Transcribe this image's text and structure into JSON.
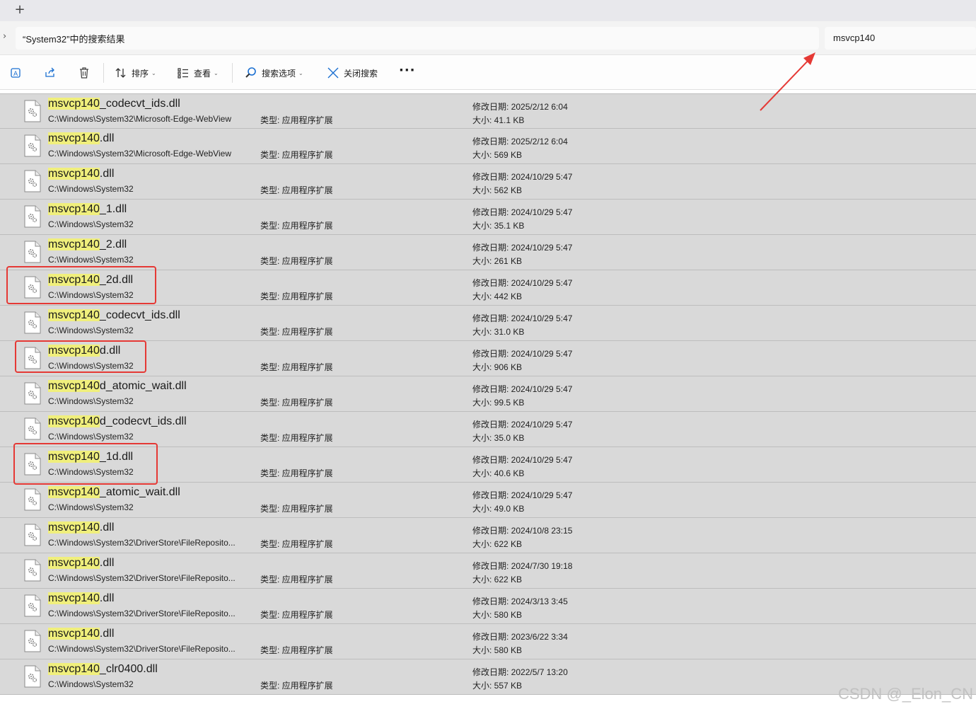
{
  "tabbar": {
    "new_tab_symbol": "+"
  },
  "address": {
    "chevron_symbol": "›",
    "path_text": "“System32”中的搜索结果",
    "search_value": "msvcp140"
  },
  "toolbar": {
    "sort_label": "排序",
    "view_label": "查看",
    "search_options_label": "搜索选项",
    "close_search_label": "关闭搜索",
    "more_symbol": "···",
    "dropdown_symbol": "⌄",
    "icons": [
      "rename-icon",
      "share-icon",
      "delete-icon",
      "sort-icon",
      "view-icon",
      "search-options-icon",
      "close-icon",
      "more-icon"
    ]
  },
  "labels": {
    "type_prefix": "类型: ",
    "date_prefix": "修改日期: ",
    "size_prefix": "大小: "
  },
  "results": [
    {
      "highlight": "msvcp140",
      "rest": "_codecvt_ids.dll",
      "path": "C:\\Windows\\System32\\Microsoft-Edge-WebView",
      "type": "应用程序扩展",
      "date": "2025/2/12 6:04",
      "size": "41.1 KB"
    },
    {
      "highlight": "msvcp140",
      "rest": ".dll",
      "path": "C:\\Windows\\System32\\Microsoft-Edge-WebView",
      "type": "应用程序扩展",
      "date": "2025/2/12 6:04",
      "size": "569 KB"
    },
    {
      "highlight": "msvcp140",
      "rest": ".dll",
      "path": "C:\\Windows\\System32",
      "type": "应用程序扩展",
      "date": "2024/10/29 5:47",
      "size": "562 KB"
    },
    {
      "highlight": "msvcp140",
      "rest": "_1.dll",
      "path": "C:\\Windows\\System32",
      "type": "应用程序扩展",
      "date": "2024/10/29 5:47",
      "size": "35.1 KB"
    },
    {
      "highlight": "msvcp140",
      "rest": "_2.dll",
      "path": "C:\\Windows\\System32",
      "type": "应用程序扩展",
      "date": "2024/10/29 5:47",
      "size": "261 KB"
    },
    {
      "highlight": "msvcp140",
      "rest": "_2d.dll",
      "path": "C:\\Windows\\System32",
      "type": "应用程序扩展",
      "date": "2024/10/29 5:47",
      "size": "442 KB"
    },
    {
      "highlight": "msvcp140",
      "rest": "_codecvt_ids.dll",
      "path": "C:\\Windows\\System32",
      "type": "应用程序扩展",
      "date": "2024/10/29 5:47",
      "size": "31.0 KB"
    },
    {
      "highlight": "msvcp140",
      "rest": "d.dll",
      "path": "C:\\Windows\\System32",
      "type": "应用程序扩展",
      "date": "2024/10/29 5:47",
      "size": "906 KB"
    },
    {
      "highlight": "msvcp140",
      "rest": "d_atomic_wait.dll",
      "path": "C:\\Windows\\System32",
      "type": "应用程序扩展",
      "date": "2024/10/29 5:47",
      "size": "99.5 KB"
    },
    {
      "highlight": "msvcp140",
      "rest": "d_codecvt_ids.dll",
      "path": "C:\\Windows\\System32",
      "type": "应用程序扩展",
      "date": "2024/10/29 5:47",
      "size": "35.0 KB"
    },
    {
      "highlight": "msvcp140",
      "rest": "_1d.dll",
      "path": "C:\\Windows\\System32",
      "type": "应用程序扩展",
      "date": "2024/10/29 5:47",
      "size": "40.6 KB"
    },
    {
      "highlight": "msvcp140",
      "rest": "_atomic_wait.dll",
      "path": "C:\\Windows\\System32",
      "type": "应用程序扩展",
      "date": "2024/10/29 5:47",
      "size": "49.0 KB"
    },
    {
      "highlight": "msvcp140",
      "rest": ".dll",
      "path": "C:\\Windows\\System32\\DriverStore\\FileReposito...",
      "type": "应用程序扩展",
      "date": "2024/10/8 23:15",
      "size": "622 KB"
    },
    {
      "highlight": "msvcp140",
      "rest": ".dll",
      "path": "C:\\Windows\\System32\\DriverStore\\FileReposito...",
      "type": "应用程序扩展",
      "date": "2024/7/30 19:18",
      "size": "622 KB"
    },
    {
      "highlight": "msvcp140",
      "rest": ".dll",
      "path": "C:\\Windows\\System32\\DriverStore\\FileReposito...",
      "type": "应用程序扩展",
      "date": "2024/3/13 3:45",
      "size": "580 KB"
    },
    {
      "highlight": "msvcp140",
      "rest": ".dll",
      "path": "C:\\Windows\\System32\\DriverStore\\FileReposito...",
      "type": "应用程序扩展",
      "date": "2023/6/22 3:34",
      "size": "580 KB"
    },
    {
      "highlight": "msvcp140",
      "rest": "_clr0400.dll",
      "path": "C:\\Windows\\System32",
      "type": "应用程序扩展",
      "date": "2022/5/7 13:20",
      "size": "557 KB"
    }
  ],
  "annotations": {
    "color": "#e53935",
    "highlighted_rows": [
      5,
      7,
      10
    ]
  },
  "watermark": "CSDN @_Elon_CN",
  "colors": {
    "highlight": "#f0ef7c",
    "row_background": "#d9d9d9",
    "annotation": "#e53935"
  }
}
